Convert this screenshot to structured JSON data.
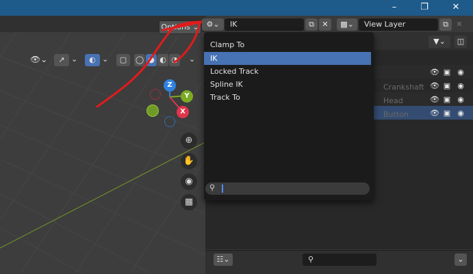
{
  "window": {
    "minimize_icon": "minimize-icon",
    "maximize_icon": "maximize-icon",
    "close_icon": "close-icon"
  },
  "header": {
    "constraint_field": {
      "value": "IK"
    },
    "view_layer_field": {
      "value": "View Layer"
    }
  },
  "viewport": {
    "options_label": "Options",
    "gizmo": {
      "z": "Z",
      "y": "Y",
      "x": "X"
    }
  },
  "menu": {
    "items": [
      {
        "label": "Clamp To",
        "selected": false
      },
      {
        "label": "IK",
        "selected": true
      },
      {
        "label": "Locked Track",
        "selected": false
      },
      {
        "label": "Spline IK",
        "selected": false
      },
      {
        "label": "Track To",
        "selected": false
      }
    ],
    "search": {
      "value": ""
    }
  },
  "outliner_faint": {
    "row1": "Crankshaft",
    "row2": "Head",
    "row3": "Button"
  },
  "colors": {
    "accent": "#4772b3",
    "topbar": "#1e5a8a",
    "annotation": "#e11b1b"
  }
}
